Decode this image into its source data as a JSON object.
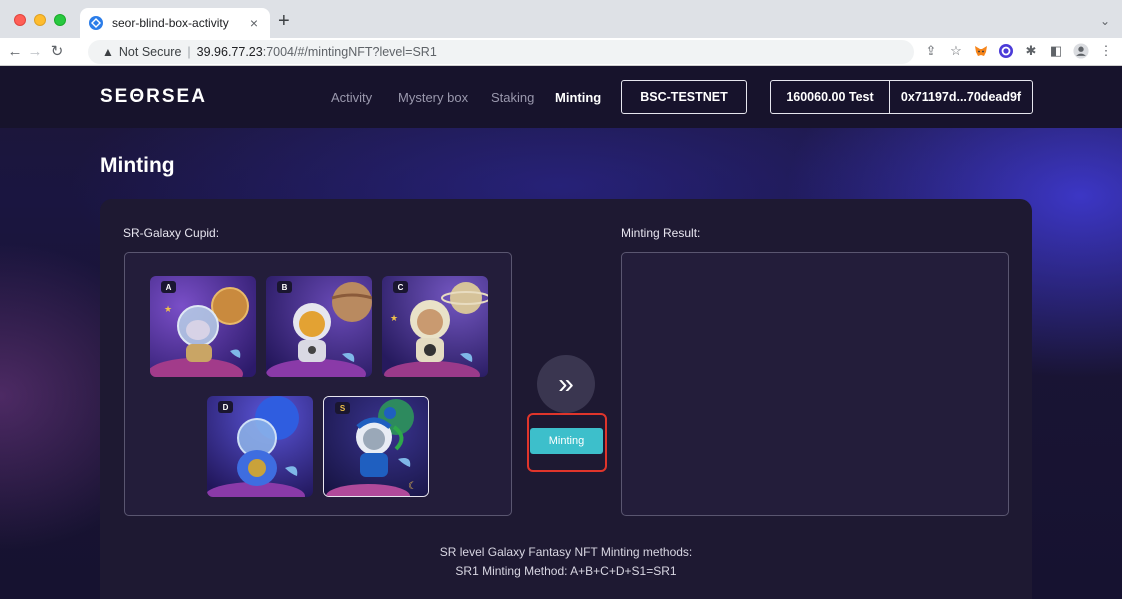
{
  "browser": {
    "tab_title": "seor-blind-box-activity",
    "tab_close": "×",
    "new_tab": "+",
    "tab_menu": "⌄",
    "security_label": "Not Secure",
    "url_host": "39.96.77.23",
    "url_rest": ":7004/#/mintingNFT?level=SR1",
    "icons": [
      "back-arrow",
      "forward-arrow",
      "reload",
      "warning",
      "share",
      "star",
      "metamask-fox",
      "extension-circle",
      "puzzle",
      "sidebar",
      "profile",
      "kebab-menu"
    ]
  },
  "nav": {
    "logo": "SEΘRSEA",
    "links": [
      {
        "label": "Activity",
        "active": false
      },
      {
        "label": "Mystery box",
        "active": false
      },
      {
        "label": "Staking",
        "active": false
      },
      {
        "label": "Minting",
        "active": true
      }
    ],
    "network": "BSC-TESTNET",
    "balance": "160060.00 Test",
    "address": "0x71197d...70dead9f"
  },
  "page": {
    "title": "Minting",
    "source_label": "SR-Galaxy Cupid:",
    "result_label": "Minting Result:",
    "nfts": [
      {
        "tag": "A",
        "selected": false
      },
      {
        "tag": "B",
        "selected": false
      },
      {
        "tag": "C",
        "selected": false
      },
      {
        "tag": "D",
        "selected": false
      },
      {
        "tag": "S",
        "selected": true
      }
    ],
    "arrow_symbol": "»",
    "mint_button": "Minting",
    "method_title": "SR level Galaxy Fantasy NFT Minting methods:",
    "method_line": "SR1 Minting Method: A+B+C+D+S1=SR1"
  },
  "colors": {
    "accent": "#3dbfcb",
    "highlight": "#e0352b",
    "page_bg": "#1a1540",
    "card_bg": "#1e1932"
  }
}
